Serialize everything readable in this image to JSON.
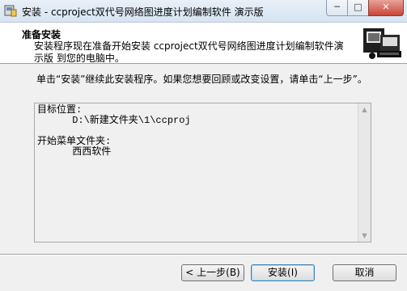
{
  "window": {
    "title": "安装 - ccproject双代号网络图进度计划编制软件 演示版",
    "minimize_glyph": "─",
    "maximize_glyph": "□",
    "close_glyph": "✕"
  },
  "header": {
    "title": "准备安装",
    "description": "安装程序现在准备开始安装 ccproject双代号网络图进度计划编制软件演示版 到您的电脑中。"
  },
  "content": {
    "intro": "单击“安装”继续此安装程序。如果您想要回顾或改变设置，请单击“上一步”。",
    "memo_text": "目标位置:\n      D:\\新建文件夹\\1\\ccproj\n\n开始菜单文件夹:\n      西西软件"
  },
  "buttons": {
    "back": "< 上一步(B)",
    "install": "安装(I)",
    "cancel": "取消"
  },
  "icons": {
    "app": "installer-app-icon",
    "header": "computer-install-icon"
  },
  "colors": {
    "close_button": "#c94534",
    "default_button_border": "#3c7fb1"
  }
}
